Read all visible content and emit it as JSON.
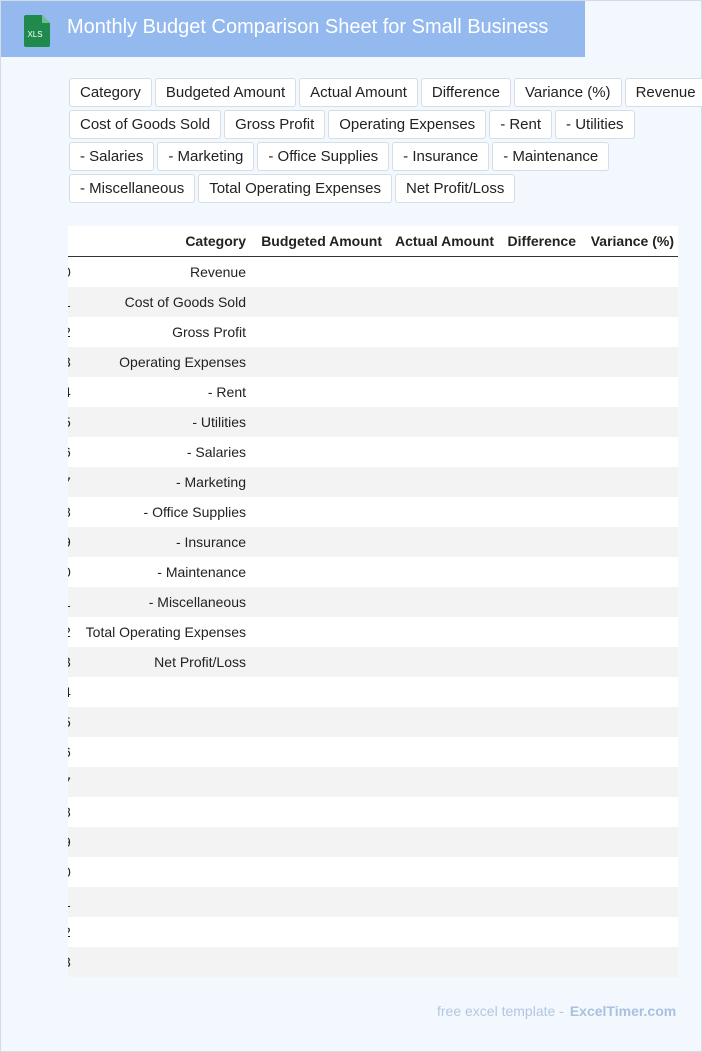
{
  "header": {
    "icon_text": "XLS",
    "title": "Monthly Budget Comparison Sheet for Small Business"
  },
  "chips": [
    [
      "Category",
      "Budgeted Amount",
      "Actual Amount",
      "Difference",
      "Variance (%)",
      "Revenue"
    ],
    [
      "Cost of Goods Sold",
      "Gross Profit",
      "Operating Expenses",
      "- Rent",
      "- Utilities"
    ],
    [
      "- Salaries",
      "- Marketing",
      "- Office Supplies",
      "- Insurance",
      "- Maintenance"
    ],
    [
      "- Miscellaneous",
      "Total Operating Expenses",
      "Net Profit/Loss"
    ]
  ],
  "table": {
    "columns": [
      "Category",
      "Budgeted Amount",
      "Actual Amount",
      "Difference",
      "Variance (%)"
    ],
    "rows": [
      {
        "idx": "0",
        "category": "Revenue"
      },
      {
        "idx": "1",
        "category": "Cost of Goods Sold"
      },
      {
        "idx": "2",
        "category": "Gross Profit"
      },
      {
        "idx": "3",
        "category": "Operating Expenses"
      },
      {
        "idx": "4",
        "category": "- Rent"
      },
      {
        "idx": "5",
        "category": "- Utilities"
      },
      {
        "idx": "6",
        "category": "- Salaries"
      },
      {
        "idx": "7",
        "category": "- Marketing"
      },
      {
        "idx": "8",
        "category": "- Office Supplies"
      },
      {
        "idx": "9",
        "category": "- Insurance"
      },
      {
        "idx": "0",
        "category": "- Maintenance"
      },
      {
        "idx": "1",
        "category": "- Miscellaneous"
      },
      {
        "idx": "2",
        "category": "Total Operating Expenses"
      },
      {
        "idx": "3",
        "category": "Net Profit/Loss"
      },
      {
        "idx": "4",
        "category": ""
      },
      {
        "idx": "5",
        "category": ""
      },
      {
        "idx": "6",
        "category": ""
      },
      {
        "idx": "7",
        "category": ""
      },
      {
        "idx": "8",
        "category": ""
      },
      {
        "idx": "9",
        "category": ""
      },
      {
        "idx": "0",
        "category": ""
      },
      {
        "idx": "1",
        "category": ""
      },
      {
        "idx": "2",
        "category": ""
      },
      {
        "idx": "3",
        "category": ""
      }
    ]
  },
  "footer": {
    "text": "free excel template -",
    "brand": "ExcelTimer.com"
  }
}
